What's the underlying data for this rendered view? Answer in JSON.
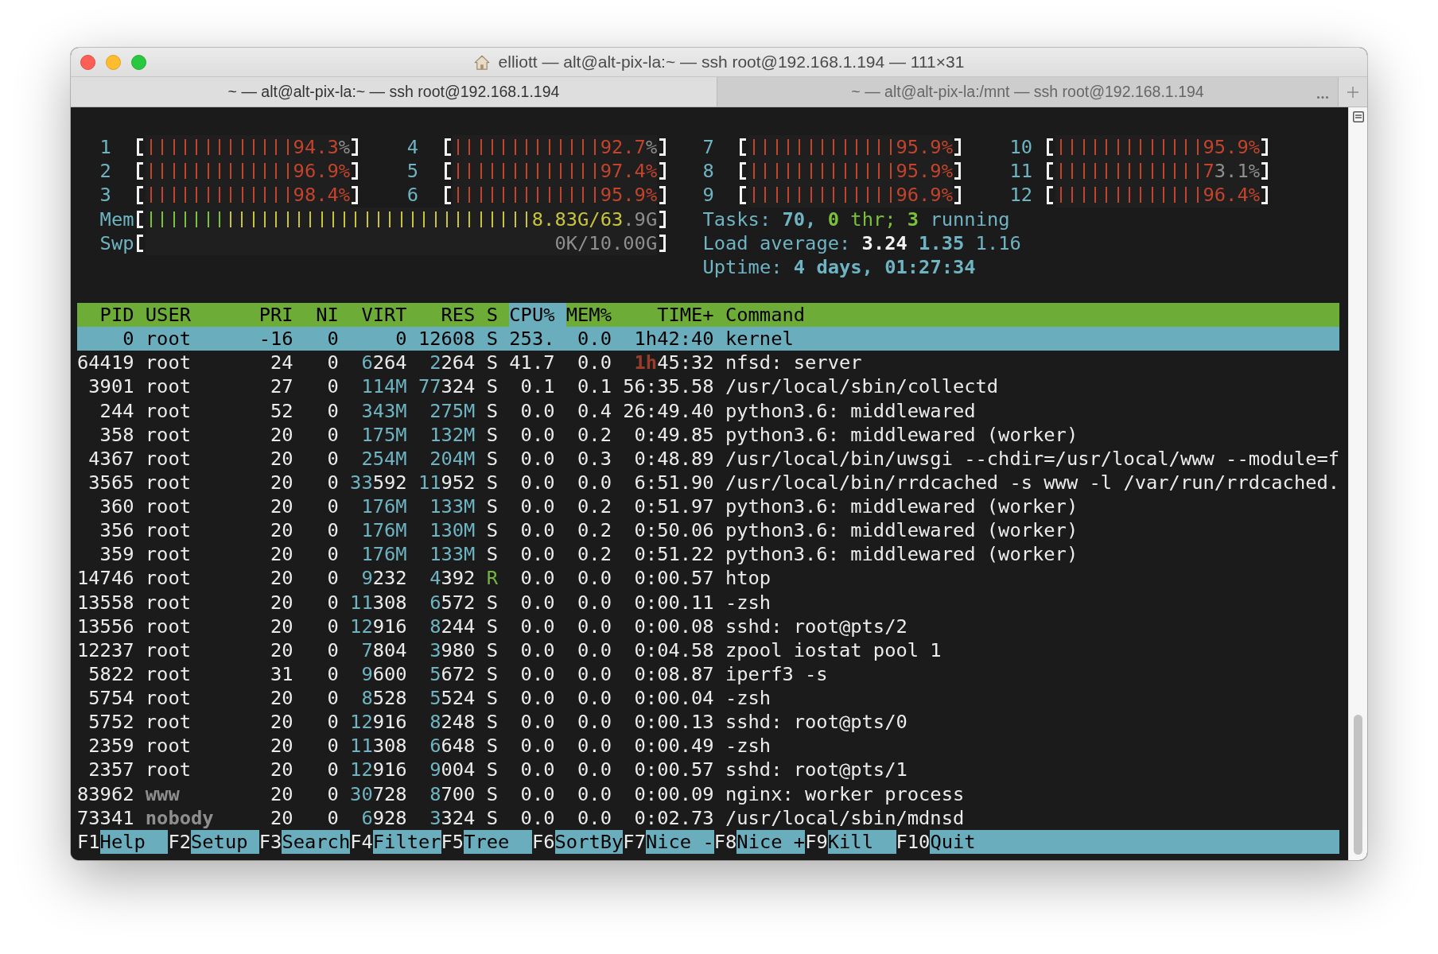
{
  "window": {
    "title": "elliott — alt@alt-pix-la:~ — ssh root@192.168.1.194 — 111×31"
  },
  "tabs": [
    {
      "label": "~ — alt@alt-pix-la:~ — ssh root@192.168.1.194",
      "selected": true
    },
    {
      "label": "~ — alt@alt-pix-la:/mnt — ssh root@192.168.1.194",
      "selected": false
    }
  ],
  "cpu_meters": [
    {
      "label": "1",
      "level": 0.943,
      "reading": "94.3%"
    },
    {
      "label": "4",
      "level": 0.927,
      "reading": "92.7%"
    },
    {
      "label": "7",
      "level": 0.959,
      "reading": "95.9%"
    },
    {
      "label": "10",
      "level": 0.959,
      "reading": "95.9%"
    },
    {
      "label": "2",
      "level": 0.969,
      "reading": "96.9%"
    },
    {
      "label": "5",
      "level": 0.974,
      "reading": "97.4%"
    },
    {
      "label": "8",
      "level": 0.959,
      "reading": "95.9%"
    },
    {
      "label": "11",
      "level": 0.731,
      "reading": "73.1%"
    },
    {
      "label": "3",
      "level": 0.984,
      "reading": "98.4%"
    },
    {
      "label": "6",
      "level": 0.959,
      "reading": "95.9%"
    },
    {
      "label": "9",
      "level": 0.969,
      "reading": "96.9%"
    },
    {
      "label": "12",
      "level": 0.964,
      "reading": "96.4%"
    }
  ],
  "memory_meters": [
    {
      "label": "Mem",
      "segments": [
        {
          "color": "#7cc23c",
          "level": 0.15
        },
        {
          "color": "#c8c43c",
          "level": 0.92
        }
      ],
      "reading": "8.83G/63.9G"
    },
    {
      "label": "Swp",
      "reading": "0K/10.00G"
    }
  ],
  "summary": [
    {
      "parts": [
        {
          "kind": "label",
          "text": "Tasks:"
        },
        {
          "kind": "value",
          "text": "70,"
        },
        {
          "kind": "threads",
          "text": "0"
        },
        {
          "kind": "threads_label",
          "text": "thr;"
        },
        {
          "kind": "running",
          "text": "3"
        },
        {
          "kind": "label",
          "text": "running"
        }
      ]
    },
    {
      "parts": [
        {
          "kind": "label",
          "text": "Load average:"
        },
        {
          "kind": "load_1",
          "text": "3.24"
        },
        {
          "kind": "load_5",
          "text": "1.35"
        },
        {
          "kind": "load_15",
          "text": "1.16"
        }
      ]
    },
    {
      "parts": [
        {
          "kind": "label",
          "text": "Uptime:"
        },
        {
          "kind": "value",
          "text": "4 days, 01:27:34"
        }
      ]
    }
  ],
  "process_table": {
    "columns": [
      {
        "label": "PID",
        "selected": false
      },
      {
        "label": "USER",
        "selected": false
      },
      {
        "label": "PRI",
        "selected": false
      },
      {
        "label": "NI",
        "selected": false
      },
      {
        "label": "VIRT",
        "selected": false
      },
      {
        "label": "RES",
        "selected": false
      },
      {
        "label": "S",
        "selected": false
      },
      {
        "label": "CPU%",
        "selected": true
      },
      {
        "label": "MEM%",
        "selected": false
      },
      {
        "label": "TIME+",
        "selected": false
      },
      {
        "label": "Command",
        "selected": false
      }
    ],
    "rows": [
      {
        "pid": "0",
        "user": "root",
        "pri": "-16",
        "ni": "0",
        "virt": {
          "minor": "0"
        },
        "res": {
          "major": "12",
          "minor": "608"
        },
        "state": "S",
        "cpu": "253.",
        "mem": "0.0",
        "time": {
          "major": "1h",
          "minor": "42:40"
        },
        "command": "kernel",
        "selected": true,
        "running": false,
        "user_dimmed": false
      },
      {
        "pid": "64419",
        "user": "root",
        "pri": "24",
        "ni": "0",
        "virt": {
          "major": "6",
          "minor": "264"
        },
        "res": {
          "major": "2",
          "minor": "264"
        },
        "state": "S",
        "cpu": "41.7",
        "mem": "0.0",
        "time": {
          "major": "1h",
          "minor": "45:32"
        },
        "command": "nfsd: server",
        "selected": false,
        "running": false,
        "user_dimmed": false
      },
      {
        "pid": "3901",
        "user": "root",
        "pri": "27",
        "ni": "0",
        "virt": {
          "major": "114M"
        },
        "res": {
          "major": "77",
          "minor": "324"
        },
        "state": "S",
        "cpu": "0.1",
        "mem": "0.1",
        "time": {
          "minor": "56:35.58"
        },
        "command": "/usr/local/sbin/collectd",
        "selected": false,
        "running": false,
        "user_dimmed": false
      },
      {
        "pid": "244",
        "user": "root",
        "pri": "52",
        "ni": "0",
        "virt": {
          "major": "343M"
        },
        "res": {
          "major": "275M"
        },
        "state": "S",
        "cpu": "0.0",
        "mem": "0.4",
        "time": {
          "minor": "26:49.40"
        },
        "command": "python3.6: middlewared",
        "selected": false,
        "running": false,
        "user_dimmed": false
      },
      {
        "pid": "358",
        "user": "root",
        "pri": "20",
        "ni": "0",
        "virt": {
          "major": "175M"
        },
        "res": {
          "major": "132M"
        },
        "state": "S",
        "cpu": "0.0",
        "mem": "0.2",
        "time": {
          "minor": "0:49.85"
        },
        "command": "python3.6: middlewared (worker)",
        "selected": false,
        "running": false,
        "user_dimmed": false
      },
      {
        "pid": "4367",
        "user": "root",
        "pri": "20",
        "ni": "0",
        "virt": {
          "major": "254M"
        },
        "res": {
          "major": "204M"
        },
        "state": "S",
        "cpu": "0.0",
        "mem": "0.3",
        "time": {
          "minor": "0:48.89"
        },
        "command": "/usr/local/bin/uwsgi --chdir=/usr/local/www --module=f",
        "selected": false,
        "running": false,
        "user_dimmed": false
      },
      {
        "pid": "3565",
        "user": "root",
        "pri": "20",
        "ni": "0",
        "virt": {
          "major": "33",
          "minor": "592"
        },
        "res": {
          "major": "11",
          "minor": "952"
        },
        "state": "S",
        "cpu": "0.0",
        "mem": "0.0",
        "time": {
          "minor": "6:51.90"
        },
        "command": "/usr/local/bin/rrdcached -s www -l /var/run/rrdcached.",
        "selected": false,
        "running": false,
        "user_dimmed": false
      },
      {
        "pid": "360",
        "user": "root",
        "pri": "20",
        "ni": "0",
        "virt": {
          "major": "176M"
        },
        "res": {
          "major": "133M"
        },
        "state": "S",
        "cpu": "0.0",
        "mem": "0.2",
        "time": {
          "minor": "0:51.97"
        },
        "command": "python3.6: middlewared (worker)",
        "selected": false,
        "running": false,
        "user_dimmed": false
      },
      {
        "pid": "356",
        "user": "root",
        "pri": "20",
        "ni": "0",
        "virt": {
          "major": "176M"
        },
        "res": {
          "major": "130M"
        },
        "state": "S",
        "cpu": "0.0",
        "mem": "0.2",
        "time": {
          "minor": "0:50.06"
        },
        "command": "python3.6: middlewared (worker)",
        "selected": false,
        "running": false,
        "user_dimmed": false
      },
      {
        "pid": "359",
        "user": "root",
        "pri": "20",
        "ni": "0",
        "virt": {
          "major": "176M"
        },
        "res": {
          "major": "133M"
        },
        "state": "S",
        "cpu": "0.0",
        "mem": "0.2",
        "time": {
          "minor": "0:51.22"
        },
        "command": "python3.6: middlewared (worker)",
        "selected": false,
        "running": false,
        "user_dimmed": false
      },
      {
        "pid": "14746",
        "user": "root",
        "pri": "20",
        "ni": "0",
        "virt": {
          "major": "9",
          "minor": "232"
        },
        "res": {
          "major": "4",
          "minor": "392"
        },
        "state": "R",
        "cpu": "0.0",
        "mem": "0.0",
        "time": {
          "minor": "0:00.57"
        },
        "command": "htop",
        "selected": false,
        "running": true,
        "user_dimmed": false
      },
      {
        "pid": "13558",
        "user": "root",
        "pri": "20",
        "ni": "0",
        "virt": {
          "major": "11",
          "minor": "308"
        },
        "res": {
          "major": "6",
          "minor": "572"
        },
        "state": "S",
        "cpu": "0.0",
        "mem": "0.0",
        "time": {
          "minor": "0:00.11"
        },
        "command": "-zsh",
        "selected": false,
        "running": false,
        "user_dimmed": false
      },
      {
        "pid": "13556",
        "user": "root",
        "pri": "20",
        "ni": "0",
        "virt": {
          "major": "12",
          "minor": "916"
        },
        "res": {
          "major": "8",
          "minor": "244"
        },
        "state": "S",
        "cpu": "0.0",
        "mem": "0.0",
        "time": {
          "minor": "0:00.08"
        },
        "command": "sshd: root@pts/2",
        "selected": false,
        "running": false,
        "user_dimmed": false
      },
      {
        "pid": "12237",
        "user": "root",
        "pri": "20",
        "ni": "0",
        "virt": {
          "major": "7",
          "minor": "804"
        },
        "res": {
          "major": "3",
          "minor": "980"
        },
        "state": "S",
        "cpu": "0.0",
        "mem": "0.0",
        "time": {
          "minor": "0:04.58"
        },
        "command": "zpool iostat pool 1",
        "selected": false,
        "running": false,
        "user_dimmed": false
      },
      {
        "pid": "5822",
        "user": "root",
        "pri": "31",
        "ni": "0",
        "virt": {
          "major": "9",
          "minor": "600"
        },
        "res": {
          "major": "5",
          "minor": "672"
        },
        "state": "S",
        "cpu": "0.0",
        "mem": "0.0",
        "time": {
          "minor": "0:08.87"
        },
        "command": "iperf3 -s",
        "selected": false,
        "running": false,
        "user_dimmed": false
      },
      {
        "pid": "5754",
        "user": "root",
        "pri": "20",
        "ni": "0",
        "virt": {
          "major": "8",
          "minor": "528"
        },
        "res": {
          "major": "5",
          "minor": "524"
        },
        "state": "S",
        "cpu": "0.0",
        "mem": "0.0",
        "time": {
          "minor": "0:00.04"
        },
        "command": "-zsh",
        "selected": false,
        "running": false,
        "user_dimmed": false
      },
      {
        "pid": "5752",
        "user": "root",
        "pri": "20",
        "ni": "0",
        "virt": {
          "major": "12",
          "minor": "916"
        },
        "res": {
          "major": "8",
          "minor": "248"
        },
        "state": "S",
        "cpu": "0.0",
        "mem": "0.0",
        "time": {
          "minor": "0:00.13"
        },
        "command": "sshd: root@pts/0",
        "selected": false,
        "running": false,
        "user_dimmed": false
      },
      {
        "pid": "2359",
        "user": "root",
        "pri": "20",
        "ni": "0",
        "virt": {
          "major": "11",
          "minor": "308"
        },
        "res": {
          "major": "6",
          "minor": "648"
        },
        "state": "S",
        "cpu": "0.0",
        "mem": "0.0",
        "time": {
          "minor": "0:00.49"
        },
        "command": "-zsh",
        "selected": false,
        "running": false,
        "user_dimmed": false
      },
      {
        "pid": "2357",
        "user": "root",
        "pri": "20",
        "ni": "0",
        "virt": {
          "major": "12",
          "minor": "916"
        },
        "res": {
          "major": "9",
          "minor": "004"
        },
        "state": "S",
        "cpu": "0.0",
        "mem": "0.0",
        "time": {
          "minor": "0:00.57"
        },
        "command": "sshd: root@pts/1",
        "selected": false,
        "running": false,
        "user_dimmed": false
      },
      {
        "pid": "83962",
        "user": "www",
        "pri": "20",
        "ni": "0",
        "virt": {
          "major": "30",
          "minor": "728"
        },
        "res": {
          "major": "8",
          "minor": "700"
        },
        "state": "S",
        "cpu": "0.0",
        "mem": "0.0",
        "time": {
          "minor": "0:00.09"
        },
        "command": "nginx: worker process",
        "selected": false,
        "running": false,
        "user_dimmed": true
      },
      {
        "pid": "73341",
        "user": "nobody",
        "pri": "20",
        "ni": "0",
        "virt": {
          "major": "6",
          "minor": "928"
        },
        "res": {
          "major": "3",
          "minor": "324"
        },
        "state": "S",
        "cpu": "0.0",
        "mem": "0.0",
        "time": {
          "minor": "0:02.73"
        },
        "command": "/usr/local/sbin/mdnsd",
        "selected": false,
        "running": false,
        "user_dimmed": true
      }
    ]
  },
  "function_keys": [
    {
      "key": "F1",
      "label": "Help"
    },
    {
      "key": "F2",
      "label": "Setup"
    },
    {
      "key": "F3",
      "label": "Search"
    },
    {
      "key": "F4",
      "label": "Filter"
    },
    {
      "key": "F5",
      "label": "Tree"
    },
    {
      "key": "F6",
      "label": "SortBy"
    },
    {
      "key": "F7",
      "label": "Nice -"
    },
    {
      "key": "F8",
      "label": "Nice +"
    },
    {
      "key": "F9",
      "label": "Kill"
    },
    {
      "key": "F10",
      "label": "Quit"
    }
  ]
}
